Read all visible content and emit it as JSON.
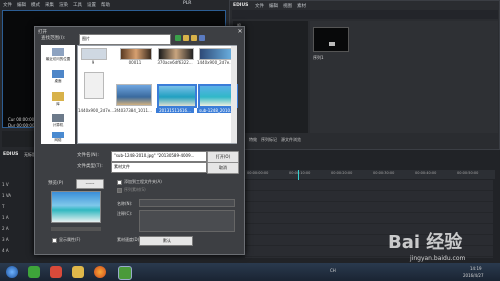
{
  "left_window": {
    "menu": [
      "文件",
      "编辑",
      "模式",
      "采集",
      "渲染",
      "工具",
      "设置",
      "帮助"
    ],
    "plr_label": "PLR",
    "tc_in": "Cur 00:00:00",
    "tc_dur": "Dur 00:00:00"
  },
  "bin_window": {
    "app_label": "EDIUS",
    "menu": [
      "文件",
      "编辑",
      "视图",
      "素材"
    ],
    "folder_label": "根",
    "clip_label": "序列1",
    "tabs": [
      "素材库",
      "特效",
      "序列标记",
      "源文件浏览"
    ]
  },
  "dialog": {
    "title": "打开",
    "lookin_label": "查找范围(I):",
    "lookin_value": "图片",
    "sidebar": [
      "最近访问的位置",
      "桌面",
      "库",
      "计算机",
      "网络"
    ],
    "files": [
      "9",
      "00011",
      "370ace6df6322...",
      "1440x900_2d7e...",
      "1440x900_2d7e...",
      "3f4037384_1011...",
      "20131511616...",
      "sub-1248_2010..."
    ],
    "filename_label": "文件名(N):",
    "filename_value": "\"sub-1248-2010.jpg\" \"20130589-4009...",
    "filetype_label": "文件类型(T):",
    "filetype_value": "素材文件",
    "open_label": "打开(O)",
    "cancel_label": "取消",
    "preview_label": "预览(P)",
    "preview_button": "------",
    "check_add_project": "添加到工程文件夹(A)",
    "check_sequence": "序列素材(S)",
    "clipname_label": "名称(N):",
    "comment_label": "注释(C):",
    "speed_label": "素材速度(D):",
    "speed_value": "默认",
    "show_info_label": "显示属性(F)"
  },
  "timeline": {
    "app_label": "EDIUS",
    "title": "无标题",
    "tracks": [
      "1 V",
      "1 VA",
      "T",
      "1 A",
      "2 A",
      "3 A",
      "4 A"
    ],
    "ruler": [
      "00:00:00:00",
      "00:00:10:00",
      "00:00:20:00",
      "00:00:30:00",
      "00:00:40:00",
      "00:00:50:00"
    ]
  },
  "taskbar": {
    "lang": "CH",
    "time": "14:19",
    "date": "2016/4/27"
  },
  "watermark": {
    "brand": "Bai 经验",
    "site": "jingyan.baidu.com"
  }
}
